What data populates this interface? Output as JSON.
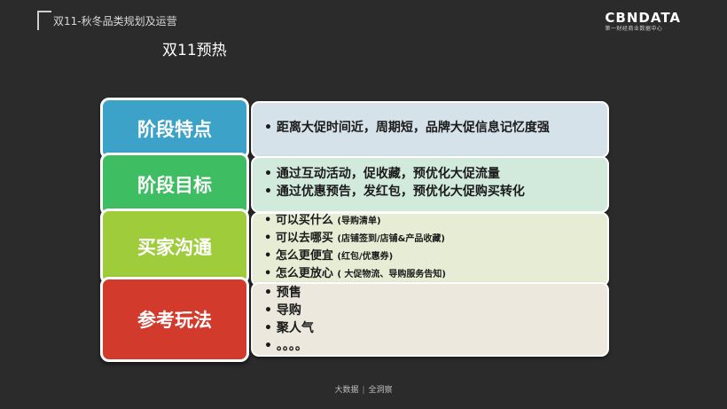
{
  "header": {
    "title": "双11-秋冬品类规划及运营",
    "brand_name": "CBNDATA",
    "brand_sub": "第一财经商业数据中心"
  },
  "slide_title": "双11预热",
  "colors": {
    "background": "#2b2b2b",
    "stage1": "#3da2c8",
    "stage2": "#3fbd62",
    "stage3": "#9fcc3b",
    "stage4": "#d23a2c",
    "panel1": "#d6e2e9",
    "panel2": "#d2eadc",
    "panel3": "#e7ecd4",
    "panel4": "#ece8dd"
  },
  "rows": [
    {
      "stage": "阶段特点",
      "items": [
        {
          "text": "• 距离大促时间近，周期短，品牌大促信息记忆度强",
          "note": ""
        }
      ]
    },
    {
      "stage": "阶段目标",
      "items": [
        {
          "text": "• 通过互动活动，促收藏，预优化大促流量",
          "note": ""
        },
        {
          "text": "• 通过优惠预告，发红包，预优化大促购买转化",
          "note": ""
        }
      ]
    },
    {
      "stage": "买家沟通",
      "items": [
        {
          "text": "• 可以买什么",
          "note": "(导购清单)"
        },
        {
          "text": "• 可以去哪买",
          "note": "(店铺签到/店铺&产品收藏)"
        },
        {
          "text": "• 怎么更便宜",
          "note": "(红包/优惠券)"
        },
        {
          "text": "• 怎么更放心",
          "note": "( 大促物流、导购服务告知)"
        }
      ]
    },
    {
      "stage": "参考玩法",
      "items": [
        {
          "text": "• 预售",
          "note": ""
        },
        {
          "text": "• 导购",
          "note": ""
        },
        {
          "text": "• 聚人气",
          "note": ""
        },
        {
          "text": "• 。。。。",
          "note": ""
        }
      ]
    }
  ],
  "footer": {
    "left": "大数据",
    "right": "全洞察"
  }
}
